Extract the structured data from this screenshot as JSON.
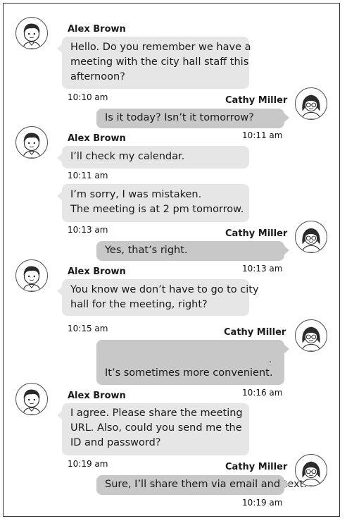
{
  "messages": [
    {
      "sender": "Alex Brown",
      "side": "left",
      "lines": [
        "Hello. Do you remember we have a",
        "meeting with the city hall staff this",
        "afternoon?"
      ],
      "time": "10:10 am",
      "avatar": "male-avatar-icon"
    },
    {
      "sender": "Cathy Miller",
      "side": "right",
      "lines": [
        "Is it today? Isn’t it tomorrow?"
      ],
      "time": "10:11 am",
      "avatar": "female-avatar-icon"
    },
    {
      "sender": "Alex Brown",
      "side": "left",
      "lines": [
        "I’ll check my calendar."
      ],
      "time": "10:11 am",
      "avatar": "male-avatar-icon"
    },
    {
      "sender": "Alex Brown",
      "side": "left",
      "lines": [
        "I’m sorry, I was mistaken.",
        "The meeting is at 2 pm tomorrow."
      ],
      "time": "10:13 am"
    },
    {
      "sender": "Cathy Miller",
      "side": "right",
      "lines": [
        "Yes, that’s right."
      ],
      "time": "10:13 am",
      "avatar": "female-avatar-icon"
    },
    {
      "sender": "Alex Brown",
      "side": "left",
      "lines": [
        "You know we don’t have to go to city",
        "hall for the meeting, right?"
      ],
      "time": "10:15 am",
      "avatar": "male-avatar-icon"
    },
    {
      "sender": "Cathy Miller",
      "side": "right",
      "lines": [
        "It’s sometimes more convenient."
      ],
      "time": "10:16 am",
      "avatar": "female-avatar-icon",
      "extra_mark": "."
    },
    {
      "sender": "Alex Brown",
      "side": "left",
      "lines": [
        "I agree. Please share the meeting",
        "URL. Also, could you send me the",
        "ID and password?"
      ],
      "time": "10:19 am",
      "avatar": "male-avatar-icon"
    },
    {
      "sender": "Cathy Miller",
      "side": "right",
      "lines": [
        "Sure, I’ll share them via email and text."
      ],
      "time": "10:19 am",
      "avatar": "female-avatar-icon"
    }
  ],
  "colors": {
    "left_bubble": "#e6e6e6",
    "right_bubble": "#c8c8c8",
    "border": "#333333"
  }
}
